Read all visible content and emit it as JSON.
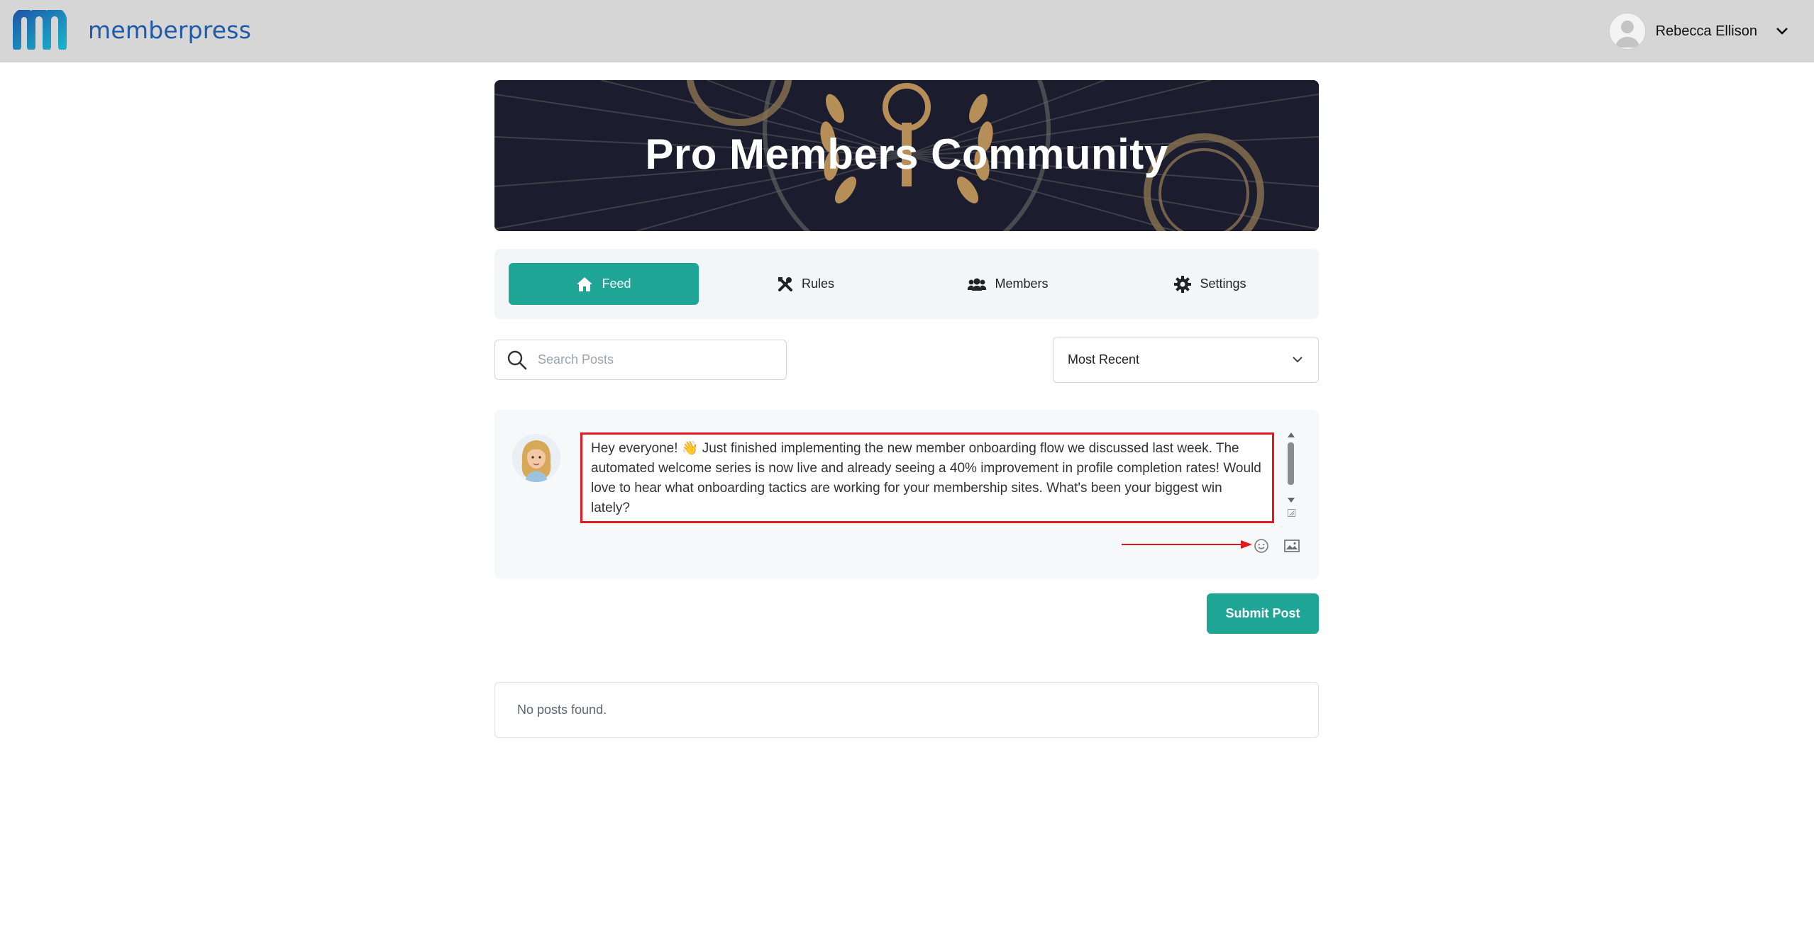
{
  "header": {
    "logo_text": "memberpress",
    "user_name": "Rebecca Ellison"
  },
  "banner": {
    "title": "Pro Members Community"
  },
  "tabs": [
    {
      "label": "Feed",
      "icon": "home-icon",
      "active": true
    },
    {
      "label": "Rules",
      "icon": "tools-icon",
      "active": false
    },
    {
      "label": "Members",
      "icon": "users-icon",
      "active": false
    },
    {
      "label": "Settings",
      "icon": "gear-icon",
      "active": false
    }
  ],
  "search": {
    "placeholder": "Search Posts",
    "value": ""
  },
  "sort": {
    "selected": "Most Recent"
  },
  "composer": {
    "text": "Hey everyone! 👋 Just finished implementing the new member onboarding flow we discussed last week. The automated welcome series is now live and already seeing a 40% improvement in profile completion rates! Would love to hear what onboarding tactics are working for your membership sites. What's been your biggest win lately?",
    "submit_label": "Submit Post"
  },
  "feed": {
    "empty_message": "No posts found."
  },
  "colors": {
    "accent": "#1ea596",
    "topbar": "#d6d6d6",
    "annotation": "#e5171f",
    "logo": "#1e5aa8"
  }
}
